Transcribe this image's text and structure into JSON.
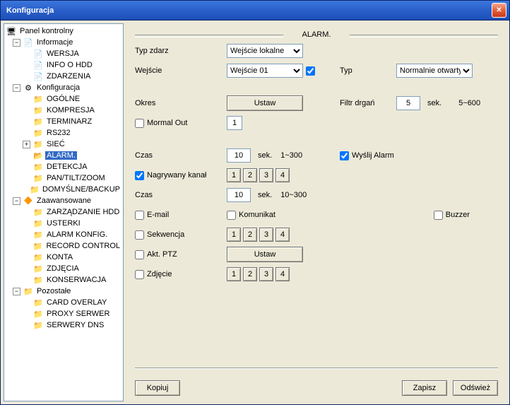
{
  "window": {
    "title": "Konfiguracja"
  },
  "tree": {
    "panel_kontrolny": "Panel kontrolny",
    "informacje": "Informacje",
    "wersja": "WERSJA",
    "info_hdd": "INFO O HDD",
    "zdarzenia": "ZDARZENIA",
    "konfiguracja": "Konfiguracja",
    "ogolne": "OGÓLNE",
    "kompresja": "KOMPRESJA",
    "terminarz": "TERMINARZ",
    "rs232": "RS232",
    "siec": "SIEĆ",
    "alarm": "ALARM.",
    "detekcja": "DETEKCJA",
    "ptz": "PAN/TILT/ZOOM",
    "domyslne": "DOMYŚLNE/BACKUP",
    "zaawansowane": "Zaawansowane",
    "zarz_hdd": "ZARZĄDZANIE HDD",
    "usterki": "USTERKI",
    "alarm_konfig": "ALARM KONFIG.",
    "record_control": "RECORD CONTROL",
    "konta": "KONTA",
    "zdjecia": "ZDJĘCIA",
    "konserwacja": "KONSERWACJA",
    "pozostale": "Pozostałe",
    "card_overlay": "CARD OVERLAY",
    "proxy": "PROXY SERWER",
    "dns": "SERWERY DNS"
  },
  "form": {
    "section_title": "ALARM.",
    "typ_zdarz_label": "Typ zdarz",
    "typ_zdarz_value": "Wejście lokalne",
    "wejscie_label": "Wejście",
    "wejscie_value": "Wejście 01",
    "typ_label": "Typ",
    "typ_value": "Normalnie otwarty",
    "okres_label": "Okres",
    "ustaw_btn": "Ustaw",
    "filtr_label": "Filtr drgań",
    "filtr_value": "5",
    "sek": "sek.",
    "filtr_range": "5~600",
    "mormal_out": "Mormal Out",
    "mormal_val": "1",
    "czas_label": "Czas",
    "czas1_value": "10",
    "czas1_range": "1~300",
    "wyslij_alarm": "Wyślij Alarm",
    "nagr_kanal": "Nagrywany kanał",
    "ch": {
      "c1": "1",
      "c2": "2",
      "c3": "3",
      "c4": "4"
    },
    "czas2_value": "10",
    "czas2_range": "10~300",
    "email_label": "E-mail",
    "komunikat_label": "Komunikat",
    "buzzer_label": "Buzzer",
    "sekwencja_label": "Sekwencja",
    "akt_ptz_label": "Akt. PTZ",
    "zdjecie_label": "Zdjęcie",
    "kopiuj_btn": "Kopiuj",
    "zapisz_btn": "Zapisz",
    "odswiez_btn": "Odśwież"
  }
}
